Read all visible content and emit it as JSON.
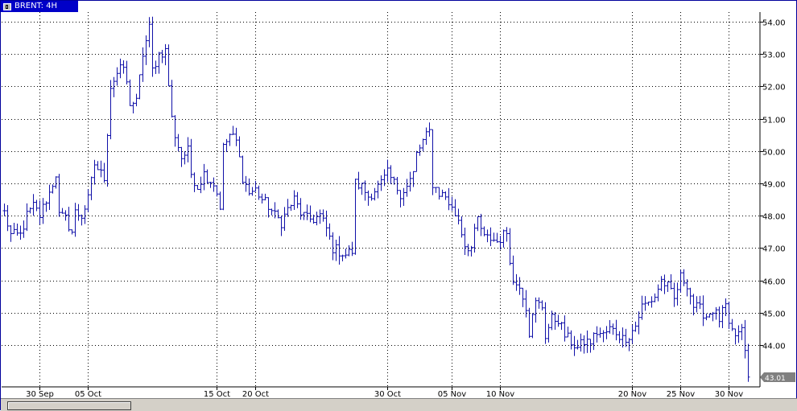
{
  "window": {
    "title": "BRENT: 4H"
  },
  "colors": {
    "series": "#1010a8",
    "axis": "#000000",
    "grid": "#000000",
    "background": "#ffffff",
    "last_price_bg": "#808080"
  },
  "chart_data": {
    "type": "ohlc",
    "title": "BRENT: 4H",
    "xlabel": "",
    "ylabel": "",
    "ylim": [
      42.8,
      54.4
    ],
    "y_ticks": [
      "44.00",
      "45.00",
      "46.00",
      "47.00",
      "48.00",
      "49.00",
      "50.00",
      "51.00",
      "52.00",
      "53.00",
      "54.00"
    ],
    "x_ticks": [
      {
        "label": "30 Sep",
        "bar": 11
      },
      {
        "label": "05 Oct",
        "bar": 26
      },
      {
        "label": "15 Oct",
        "bar": 66
      },
      {
        "label": "20 Oct",
        "bar": 78
      },
      {
        "label": "30 Oct",
        "bar": 119
      },
      {
        "label": "05 Nov",
        "bar": 139
      },
      {
        "label": "10 Nov",
        "bar": 154
      },
      {
        "label": "20 Nov",
        "bar": 195
      },
      {
        "label": "25 Nov",
        "bar": 210
      },
      {
        "label": "30 Nov",
        "bar": 225
      }
    ],
    "grid": true,
    "last_price": "43.01",
    "series": [
      {
        "keypoints": [
          [
            0,
            48.1
          ],
          [
            2,
            47.4
          ],
          [
            5,
            47.4
          ],
          [
            7,
            48.0
          ],
          [
            9,
            48.3
          ],
          [
            11,
            48.0
          ],
          [
            13,
            48.5
          ],
          [
            14,
            48.7
          ],
          [
            16,
            49.3
          ],
          [
            17,
            48.0
          ],
          [
            19,
            47.9
          ],
          [
            21,
            47.5
          ],
          [
            22,
            48.1
          ],
          [
            24,
            48.0
          ],
          [
            26,
            48.5
          ],
          [
            28,
            49.6
          ],
          [
            30,
            49.3
          ],
          [
            31,
            49.2
          ],
          [
            33,
            52.0
          ],
          [
            35,
            52.4
          ],
          [
            37,
            52.6
          ],
          [
            39,
            51.5
          ],
          [
            41,
            51.5
          ],
          [
            43,
            53.0
          ],
          [
            45,
            53.8
          ],
          [
            46,
            52.5
          ],
          [
            48,
            53.0
          ],
          [
            50,
            53.1
          ],
          [
            52,
            51.0
          ],
          [
            53,
            50.5
          ],
          [
            55,
            49.8
          ],
          [
            57,
            50.0
          ],
          [
            58,
            49.3
          ],
          [
            60,
            48.9
          ],
          [
            62,
            49.3
          ],
          [
            63,
            49.2
          ],
          [
            65,
            49.0
          ],
          [
            66,
            48.7
          ],
          [
            67,
            48.3
          ],
          [
            68,
            50.1
          ],
          [
            70,
            50.5
          ],
          [
            72,
            50.3
          ],
          [
            74,
            49.2
          ],
          [
            76,
            48.7
          ],
          [
            78,
            48.8
          ],
          [
            80,
            48.5
          ],
          [
            82,
            48.3
          ],
          [
            84,
            48.0
          ],
          [
            86,
            47.8
          ],
          [
            88,
            48.2
          ],
          [
            90,
            48.5
          ],
          [
            92,
            48.1
          ],
          [
            94,
            47.9
          ],
          [
            96,
            47.9
          ],
          [
            98,
            48.0
          ],
          [
            100,
            47.6
          ],
          [
            102,
            47.0
          ],
          [
            104,
            46.9
          ],
          [
            106,
            46.8
          ],
          [
            108,
            46.9
          ],
          [
            109,
            49.0
          ],
          [
            111,
            48.9
          ],
          [
            113,
            48.6
          ],
          [
            115,
            48.8
          ],
          [
            117,
            49.0
          ],
          [
            119,
            49.3
          ],
          [
            121,
            49.0
          ],
          [
            123,
            48.7
          ],
          [
            125,
            48.9
          ],
          [
            127,
            49.3
          ],
          [
            128,
            49.9
          ],
          [
            130,
            50.3
          ],
          [
            132,
            50.6
          ],
          [
            133,
            49.0
          ],
          [
            135,
            48.7
          ],
          [
            137,
            48.6
          ],
          [
            139,
            48.2
          ],
          [
            141,
            47.9
          ],
          [
            143,
            47.1
          ],
          [
            145,
            47.0
          ],
          [
            147,
            47.9
          ],
          [
            149,
            47.3
          ],
          [
            151,
            47.3
          ],
          [
            153,
            47.2
          ],
          [
            155,
            47.4
          ],
          [
            156,
            47.5
          ],
          [
            158,
            45.9
          ],
          [
            160,
            45.9
          ],
          [
            162,
            45.2
          ],
          [
            163,
            44.4
          ],
          [
            165,
            45.3
          ],
          [
            167,
            45.2
          ],
          [
            168,
            44.3
          ],
          [
            170,
            44.8
          ],
          [
            172,
            44.8
          ],
          [
            174,
            44.3
          ],
          [
            176,
            44.1
          ],
          [
            178,
            43.9
          ],
          [
            180,
            44.1
          ],
          [
            182,
            44.1
          ],
          [
            184,
            44.4
          ],
          [
            186,
            44.3
          ],
          [
            188,
            44.5
          ],
          [
            190,
            44.4
          ],
          [
            192,
            44.2
          ],
          [
            194,
            44.3
          ],
          [
            196,
            44.6
          ],
          [
            198,
            45.2
          ],
          [
            200,
            45.3
          ],
          [
            202,
            45.5
          ],
          [
            204,
            46.0
          ],
          [
            206,
            45.8
          ],
          [
            208,
            45.4
          ],
          [
            210,
            46.1
          ],
          [
            212,
            45.9
          ],
          [
            214,
            45.2
          ],
          [
            216,
            45.1
          ],
          [
            218,
            44.9
          ],
          [
            220,
            45.1
          ],
          [
            222,
            44.8
          ],
          [
            224,
            45.2
          ],
          [
            225,
            44.5
          ],
          [
            227,
            44.3
          ],
          [
            229,
            44.4
          ],
          [
            230,
            43.9
          ],
          [
            231,
            43.01
          ]
        ]
      }
    ]
  }
}
